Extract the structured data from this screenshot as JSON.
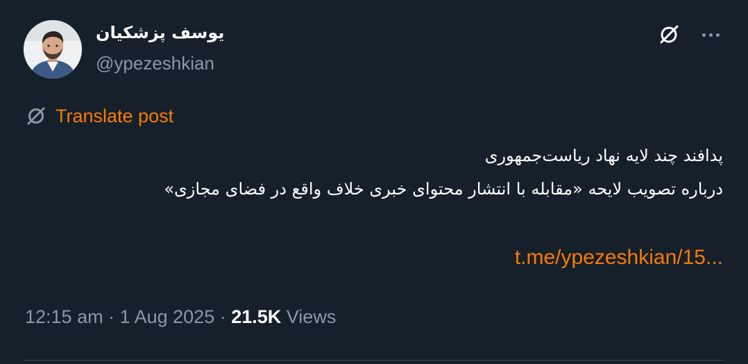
{
  "author": {
    "display_name": "یوسف پزشکیان",
    "handle": "@ypezeshkian"
  },
  "icons": {
    "grok": "grok-icon",
    "more": "more-horizontal-icon",
    "translate": "grok-translate-icon"
  },
  "translate": {
    "label": "Translate post"
  },
  "post": {
    "line1": "پدافند چند لایه نهاد ریاست‌جمهوری",
    "line2": "درباره تصویب لایحه «مقابله با انتشار محتوای خبری خلاف واقع در فضای مجازی»",
    "link": "t.me/ypezeshkian/15..."
  },
  "meta": {
    "time": "12:15 am",
    "separator1": " · ",
    "date": "1 Aug 2025",
    "separator2": " · ",
    "views_count": "21.5K",
    "views_label": " Views"
  },
  "colors": {
    "background": "#15202b",
    "accent": "#ff7a00",
    "secondary_text": "#8b98a5",
    "primary_text": "#ffffff"
  }
}
